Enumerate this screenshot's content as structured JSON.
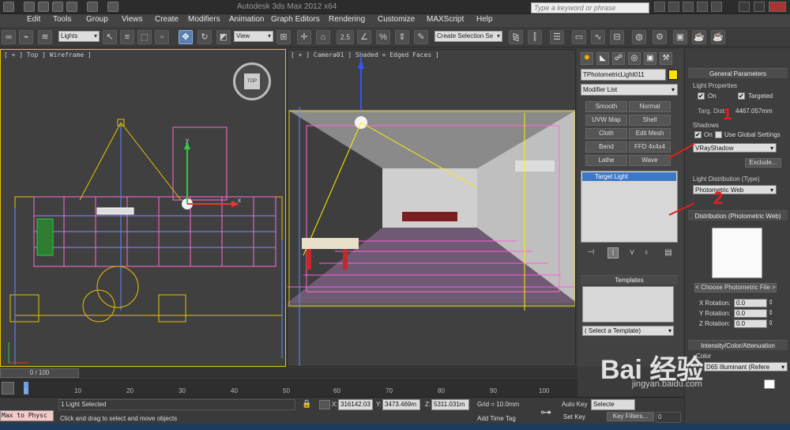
{
  "window": {
    "title": "Autodesk 3ds Max 2012 x64",
    "search_placeholder": "Type a keyword or phrase"
  },
  "menu": [
    "Edit",
    "Tools",
    "Group",
    "Views",
    "Create",
    "Modifiers",
    "Animation",
    "Graph Editors",
    "Rendering",
    "Customize",
    "MAXScript",
    "Help"
  ],
  "toolbar": {
    "selection_filter": "Lights",
    "ref_coord": "View",
    "snap_angle": "2.5",
    "named_selection": "Create Selection Se"
  },
  "viewports": {
    "top": {
      "label": "[ + ] Top ] Wireframe ]",
      "axis_x": "x",
      "axis_y": "y",
      "viewcube": "TOP"
    },
    "camera": {
      "label": "[ + ] Camera01 ] Shaded + Edged Faces ]"
    }
  },
  "command_panel": {
    "object_name": "TPhotometricLight011",
    "modifier_list": "Modifier List",
    "modifiers": [
      "Smooth",
      "Normal",
      "UVW Map",
      "Shell",
      "Cloth",
      "Edit Mesh",
      "Bend",
      "FFD 4x4x4",
      "Lathe",
      "Wave"
    ],
    "stack_item": "Target Light",
    "templates": {
      "header": "Templates",
      "select": "( Select a Template)"
    }
  },
  "general_parameters": {
    "header": "General Parameters",
    "light_properties": "Light Properties",
    "on_label": "On",
    "targeted_label": "Targeted",
    "targ_dist_label": "Targ. Dist:",
    "targ_dist_value": "4467.057mm",
    "shadows": "Shadows",
    "shadows_on": "On",
    "use_global": "Use Global Settings",
    "shadow_type": "VRayShadow",
    "exclude": "Exclude...",
    "light_distribution": "Light Distribution (Type)",
    "distribution_type": "Photometric Web",
    "annotation_1": "1",
    "annotation_2": "2"
  },
  "distribution": {
    "header": "Distribution (Photometric Web)",
    "choose": "< Choose Photometric File >",
    "x_rot_label": "X Rotation:",
    "y_rot_label": "Y Rotation:",
    "z_rot_label": "Z Rotation:",
    "x_rot": "0.0",
    "y_rot": "0.0",
    "z_rot": "0.0"
  },
  "intensity": {
    "header": "Intensity/Color/Attenuation",
    "color_label": "Color",
    "color_preset": "D65 Illuminant (Refere"
  },
  "timeline": {
    "frame": "0 / 100",
    "ticks": [
      "0",
      "10",
      "20",
      "30",
      "40",
      "50",
      "60",
      "70",
      "80",
      "90",
      "100"
    ]
  },
  "status": {
    "maxscript": "Max to Physc <",
    "selected": "1 Light Selected",
    "prompt": "Click and drag to select and move objects",
    "x_label": "X:",
    "x": "316142.03",
    "y_label": "Y:",
    "y": "3473.469m",
    "z_label": "Z:",
    "z": "5311.031m",
    "grid": "Grid = 10.0mm",
    "add_time_tag": "Add Time Tag",
    "auto_key": "Auto Key",
    "set_key": "Set Key",
    "selected_dropdown": "Selecte",
    "key_filters": "Key Filters...",
    "frame_field": "0"
  },
  "watermark": {
    "text": "Bai 经验",
    "sub": "jingyan.baidu.com"
  }
}
